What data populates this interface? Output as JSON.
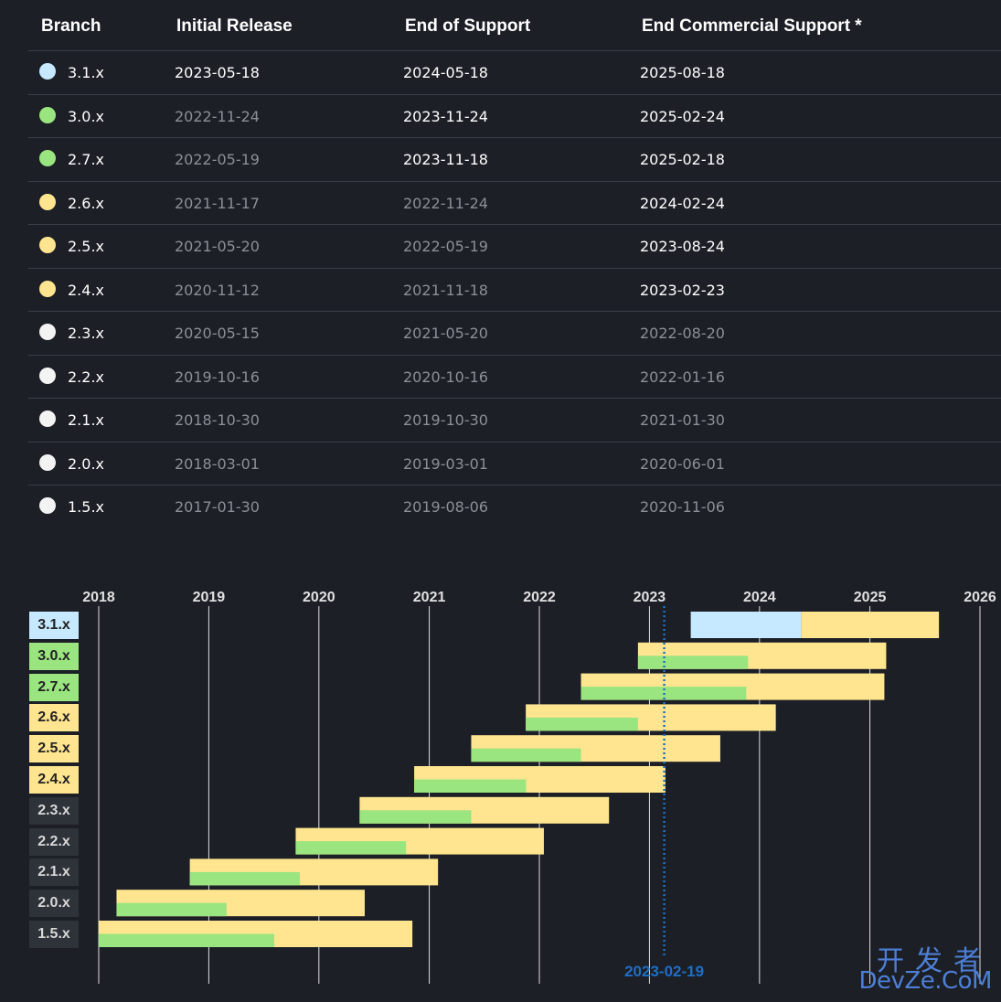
{
  "table": {
    "headers": [
      "Branch",
      "Initial Release",
      "End of Support",
      "End Commercial Support *"
    ],
    "rows": [
      {
        "branch": "3.1.x",
        "initial": "2023-05-18",
        "eos": "2024-05-18",
        "ecs": "2025-08-18",
        "color": "#c6e9ff",
        "states": [
          1,
          1,
          1
        ]
      },
      {
        "branch": "3.0.x",
        "initial": "2022-11-24",
        "eos": "2023-11-24",
        "ecs": "2025-02-24",
        "color": "#9ae57f",
        "states": [
          0,
          1,
          1
        ]
      },
      {
        "branch": "2.7.x",
        "initial": "2022-05-19",
        "eos": "2023-11-18",
        "ecs": "2025-02-18",
        "color": "#9ae57f",
        "states": [
          0,
          1,
          1
        ]
      },
      {
        "branch": "2.6.x",
        "initial": "2021-11-17",
        "eos": "2022-11-24",
        "ecs": "2024-02-24",
        "color": "#ffe58f",
        "states": [
          0,
          0,
          1
        ]
      },
      {
        "branch": "2.5.x",
        "initial": "2021-05-20",
        "eos": "2022-05-19",
        "ecs": "2023-08-24",
        "color": "#ffe58f",
        "states": [
          0,
          0,
          1
        ]
      },
      {
        "branch": "2.4.x",
        "initial": "2020-11-12",
        "eos": "2021-11-18",
        "ecs": "2023-02-23",
        "color": "#ffe58f",
        "states": [
          0,
          0,
          1
        ]
      },
      {
        "branch": "2.3.x",
        "initial": "2020-05-15",
        "eos": "2021-05-20",
        "ecs": "2022-08-20",
        "color": "#f3f3f3",
        "states": [
          0,
          0,
          0
        ]
      },
      {
        "branch": "2.2.x",
        "initial": "2019-10-16",
        "eos": "2020-10-16",
        "ecs": "2022-01-16",
        "color": "#f3f3f3",
        "states": [
          0,
          0,
          0
        ]
      },
      {
        "branch": "2.1.x",
        "initial": "2018-10-30",
        "eos": "2019-10-30",
        "ecs": "2021-01-30",
        "color": "#f3f3f3",
        "states": [
          0,
          0,
          0
        ]
      },
      {
        "branch": "2.0.x",
        "initial": "2018-03-01",
        "eos": "2019-03-01",
        "ecs": "2020-06-01",
        "color": "#f3f3f3",
        "states": [
          0,
          0,
          0
        ]
      },
      {
        "branch": "1.5.x",
        "initial": "2017-01-30",
        "eos": "2019-08-06",
        "ecs": "2020-11-06",
        "color": "#f3f3f3",
        "states": [
          0,
          0,
          0
        ]
      }
    ]
  },
  "chart_data": {
    "type": "gantt",
    "x_axis_years": [
      "2018",
      "2019",
      "2020",
      "2021",
      "2022",
      "2023",
      "2024",
      "2025",
      "2026"
    ],
    "xlim": [
      "2018-01-01",
      "2026-01-01"
    ],
    "grid": true,
    "today_marker": "2023-02-19",
    "series": [
      {
        "branch": "3.1.x",
        "start": "2023-05-18",
        "eos": "2024-05-18",
        "ecs": "2025-08-18",
        "status": "current",
        "label_bg": "#c6e9ff",
        "label_fg": "#222222"
      },
      {
        "branch": "3.0.x",
        "start": "2022-11-24",
        "eos": "2023-11-24",
        "ecs": "2025-02-24",
        "status": "supported",
        "label_bg": "#9ae57f",
        "label_fg": "#222222"
      },
      {
        "branch": "2.7.x",
        "start": "2022-05-19",
        "eos": "2023-11-18",
        "ecs": "2025-02-18",
        "status": "supported",
        "label_bg": "#9ae57f",
        "label_fg": "#222222"
      },
      {
        "branch": "2.6.x",
        "start": "2021-11-17",
        "eos": "2022-11-24",
        "ecs": "2024-02-24",
        "status": "commercial",
        "label_bg": "#ffe58f",
        "label_fg": "#222222"
      },
      {
        "branch": "2.5.x",
        "start": "2021-05-20",
        "eos": "2022-05-19",
        "ecs": "2023-08-24",
        "status": "commercial",
        "label_bg": "#ffe58f",
        "label_fg": "#222222"
      },
      {
        "branch": "2.4.x",
        "start": "2020-11-12",
        "eos": "2021-11-18",
        "ecs": "2023-02-23",
        "status": "commercial",
        "label_bg": "#ffe58f",
        "label_fg": "#222222"
      },
      {
        "branch": "2.3.x",
        "start": "2020-05-15",
        "eos": "2021-05-20",
        "ecs": "2022-08-20",
        "status": "eol",
        "label_bg": "#2e3239",
        "label_fg": "#d8d8d8"
      },
      {
        "branch": "2.2.x",
        "start": "2019-10-16",
        "eos": "2020-10-16",
        "ecs": "2022-01-16",
        "status": "eol",
        "label_bg": "#2e3239",
        "label_fg": "#d8d8d8"
      },
      {
        "branch": "2.1.x",
        "start": "2018-10-30",
        "eos": "2019-10-30",
        "ecs": "2021-01-30",
        "status": "eol",
        "label_bg": "#2e3239",
        "label_fg": "#d8d8d8"
      },
      {
        "branch": "2.0.x",
        "start": "2018-03-01",
        "eos": "2019-03-01",
        "ecs": "2020-06-01",
        "status": "eol",
        "label_bg": "#2e3239",
        "label_fg": "#d8d8d8"
      },
      {
        "branch": "1.5.x",
        "start": "2017-01-30",
        "eos": "2019-08-06",
        "ecs": "2020-11-06",
        "status": "eol",
        "label_bg": "#2e3239",
        "label_fg": "#d8d8d8"
      }
    ],
    "colors": {
      "oss_support": "#9ae57f",
      "commercial_support": "#ffe58f",
      "current_oss": "#c6e9ff",
      "today_line": "#1e6fc4",
      "grid": "#ffffff",
      "year_label": "#e0e0e0"
    }
  },
  "watermark": {
    "line1": "开发者",
    "line2": "DevZe.CoM"
  }
}
